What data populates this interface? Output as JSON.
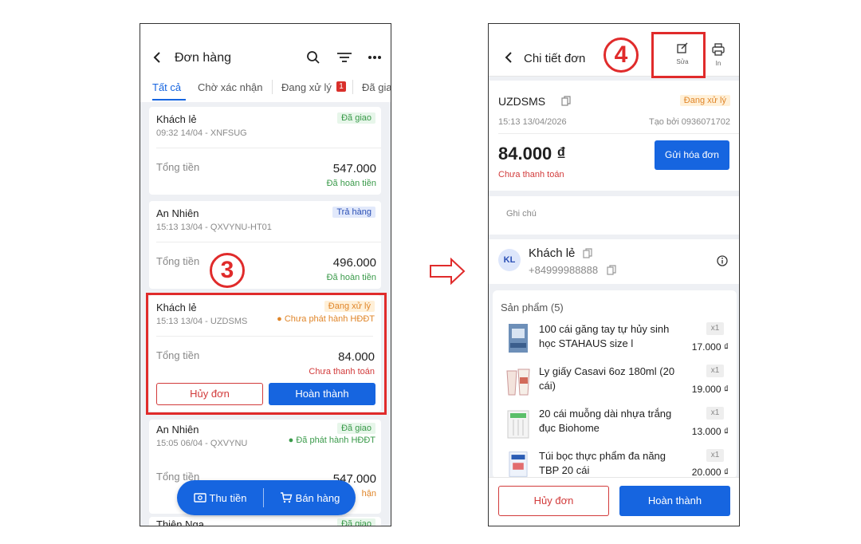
{
  "left_screen": {
    "title": "Đơn hàng",
    "tabs": [
      {
        "label": "Tất cả"
      },
      {
        "label": "Chờ xác nhận"
      },
      {
        "label": "Đang xử lý",
        "badge": "1"
      },
      {
        "label": "Đã gia"
      }
    ],
    "orders": [
      {
        "name": "Khách lẻ",
        "meta": "09:32 14/04 - XNFSUG",
        "status": "Đã giao",
        "total_label": "Tổng tiền",
        "amount": "547.000",
        "pay_status": "Đã hoàn tiền"
      },
      {
        "name": "An Nhiên",
        "meta": "15:13 13/04 - QXVYNU-HT01",
        "status": "Trả hàng",
        "total_label": "Tổng tiền",
        "amount": "496.000",
        "pay_status": "Đã hoàn tiền"
      },
      {
        "name": "Khách lẻ",
        "meta": "15:13 13/04 - UZDSMS",
        "status": "Đang xử lý",
        "invoice": "Chưa phát hành HĐĐT",
        "total_label": "Tổng tiền",
        "amount": "84.000",
        "pay_status": "Chưa thanh toán",
        "cancel": "Hủy đơn",
        "complete": "Hoàn thành"
      },
      {
        "name": "An Nhiên",
        "meta": "15:05 06/04 - QXVYNU",
        "status": "Đã giao",
        "invoice": "Đã phát hành HĐĐT",
        "total_label": "Tổng tiền",
        "amount": "547.000",
        "pay_status": "hận"
      },
      {
        "name": "Thiên Nga",
        "status": "Đã giao"
      }
    ],
    "fab": {
      "collect": "Thu tiền",
      "sell": "Bán hàng"
    },
    "step": "3"
  },
  "right_screen": {
    "title": "Chi tiết đơn",
    "edit_label": "Sửa",
    "print_label": "In",
    "step": "4",
    "order_code": "UZDSMS",
    "status": "Đang xử lý",
    "datetime": "15:13 13/04/2026",
    "created_by": "Tạo bởi 0936071702",
    "total": "84.000 ₫",
    "pay_status": "Chưa thanh toán",
    "send_invoice": "Gửi hóa đơn",
    "note_placeholder": "Ghi chú",
    "customer": {
      "initials": "KL",
      "name": "Khách lẻ",
      "phone": "+84999988888"
    },
    "products_title": "Sản phẩm (5)",
    "products": [
      {
        "name": "100 cái găng tay tự hủy sinh học STAHAUS size l",
        "qty": "x1",
        "price": "17.000 ₫"
      },
      {
        "name": "Ly giấy Casavi 6oz 180ml (20 cái)",
        "qty": "x1",
        "price": "19.000 ₫"
      },
      {
        "name": "20 cái muỗng dài nhựa trắng đục Biohome",
        "qty": "x1",
        "price": "13.000 ₫"
      },
      {
        "name": "Túi bọc thực phẩm đa năng TBP 20 cái",
        "qty": "x1",
        "price": "20.000 ₫"
      }
    ],
    "cancel": "Hủy đơn",
    "complete": "Hoàn thành"
  },
  "colors": {
    "primary": "#1665e0",
    "highlight": "#e02b2b",
    "danger": "#d23b3b",
    "success": "#3a9a4a"
  }
}
